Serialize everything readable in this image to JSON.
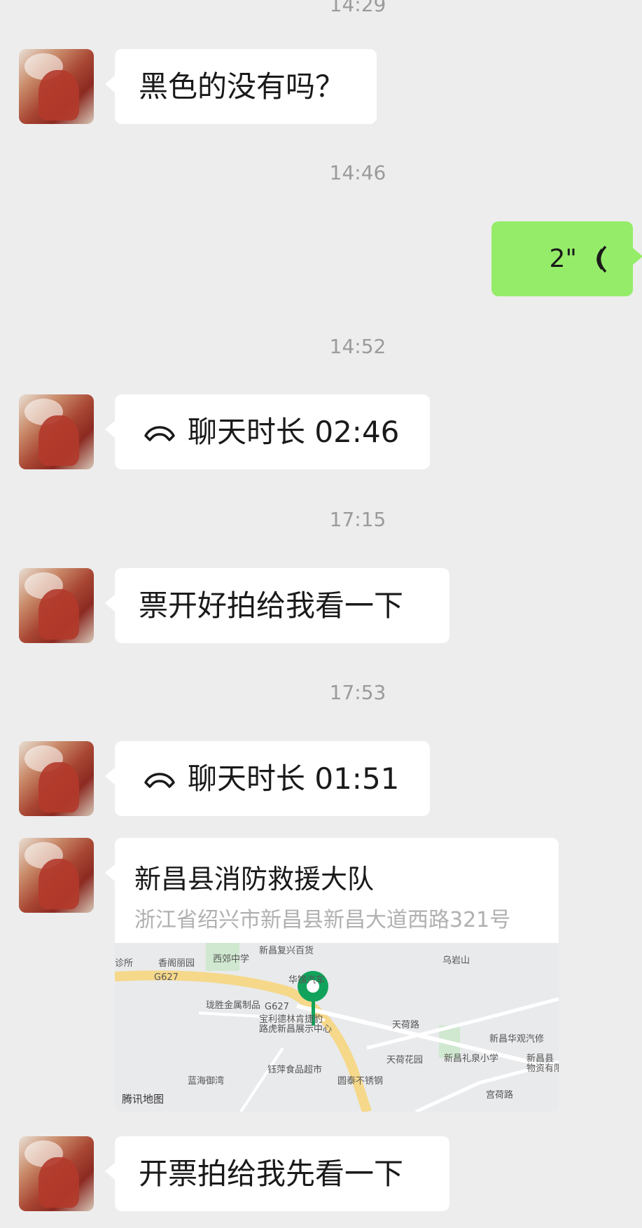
{
  "messages": [
    {
      "time": "14:29"
    },
    {
      "side": "left",
      "type": "text",
      "text": "黑色的没有吗？"
    },
    {
      "time": "14:46"
    },
    {
      "side": "right",
      "type": "voice",
      "duration": "2\""
    },
    {
      "time": "14:52"
    },
    {
      "side": "left",
      "type": "call",
      "label": "聊天时长 02:46",
      "icon": "call-hangup-icon"
    },
    {
      "time": "17:15"
    },
    {
      "side": "left",
      "type": "text",
      "text": "票开好拍给我看一下"
    },
    {
      "time": "17:53"
    },
    {
      "side": "left",
      "type": "call",
      "label": "聊天时长 01:51",
      "icon": "call-hangup-icon"
    },
    {
      "side": "left",
      "type": "location"
    },
    {
      "side": "left",
      "type": "text",
      "text": "开票拍给我先看一下"
    }
  ],
  "location": {
    "title": "新昌县消防救援大队",
    "address": "浙江省绍兴市新昌县新昌大道西路321号",
    "map_brand": "腾讯地图",
    "pin_color": "#11a35b",
    "map_labels": [
      "诊所",
      "香阁丽园",
      "西郊中学",
      "新昌复兴百货",
      "乌岩山",
      "G627",
      "华锦汽车",
      "珑胜金属制品",
      "G627",
      "宝利德林肯捷豹",
      "路虎新昌展示中心",
      "天荷路",
      "新昌华观汽修",
      "新昌礼泉小学",
      "新昌县",
      "物资有限",
      "天荷花园",
      "蓝海御湾",
      "钰萍食品超市",
      "圆泰不锈钢",
      "宫荷路"
    ]
  },
  "colors": {
    "background": "#ededed",
    "bubble_left": "#ffffff",
    "bubble_right": "#95ec69",
    "timestamp": "#9b9b9b"
  }
}
